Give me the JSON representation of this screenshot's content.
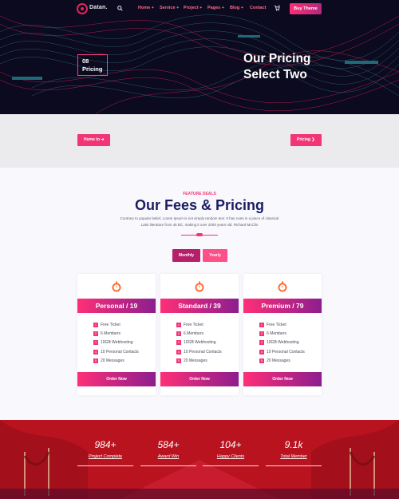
{
  "colors": {
    "accent": "#f23575",
    "accent_dark": "#8c1e8e",
    "title_navy": "#1a1c64",
    "hero_bg": "#0c0a1e",
    "stats_bg": "#b5161f"
  },
  "nav": {
    "logo_text": "Datan.",
    "menu": [
      "Home",
      "Service",
      "Project",
      "Pages",
      "Blog",
      "Contact"
    ],
    "buy_button": "Buy Theme"
  },
  "hero": {
    "number": "08",
    "label": "Pricing",
    "title": "Our Pricing Select Two"
  },
  "breadcrumb": {
    "home": "Home to",
    "current": "Pricing"
  },
  "pricing": {
    "tagline": "FEATURE DEALS",
    "title": "Our Fees & Pricing",
    "description": "Contrary to popular belief, Lorem Ipsum is not simply random text. It has roots in a piece of classical Latin literature from 45 BC, making it over 2000 years old. Richard McClin",
    "toggle_monthly": "Monthly",
    "toggle_yearly": "Yearly",
    "plans": [
      {
        "name": "Personal / 19",
        "features": [
          "Free Ticket",
          "6 Members",
          "10GB Webhosting",
          "10 Personal Contacts",
          "20 Messages"
        ],
        "button": "Order Now"
      },
      {
        "name": "Standard / 39",
        "features": [
          "Free Ticket",
          "6 Members",
          "10GB Webhosting",
          "10 Personal Contacts",
          "20 Messages"
        ],
        "button": "Order Now"
      },
      {
        "name": "Premium / 79",
        "features": [
          "Free Ticket",
          "6 Members",
          "10GB Webhosting",
          "10 Personal Contacts",
          "20 Messages"
        ],
        "button": "Order Now"
      }
    ]
  },
  "stats": [
    {
      "value": "984+",
      "label": "Project Complete"
    },
    {
      "value": "584+",
      "label": "Award Win"
    },
    {
      "value": "104+",
      "label": "Happy Clients"
    },
    {
      "value": "9.1k",
      "label": "Total Member"
    }
  ]
}
